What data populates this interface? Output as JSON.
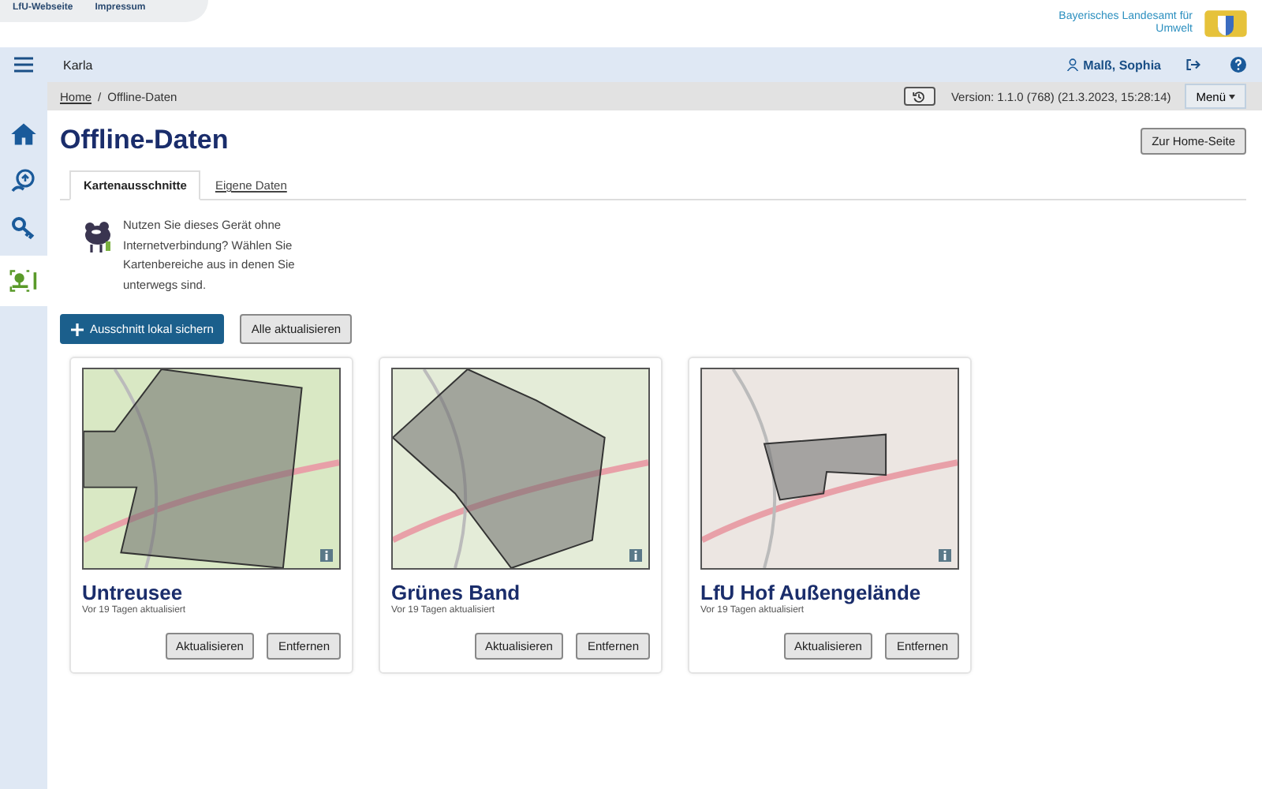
{
  "header": {
    "links": [
      "LfU-Webseite",
      "Impressum"
    ],
    "agency": "Bayerisches Landesamt für Umwelt"
  },
  "topbar": {
    "app_name": "Karla",
    "user": "Malß, Sophia"
  },
  "sidebar": {
    "items": [
      {
        "kind": "home",
        "selected": false
      },
      {
        "kind": "upload",
        "selected": false
      },
      {
        "kind": "key",
        "selected": false
      },
      {
        "kind": "map",
        "selected": true
      }
    ]
  },
  "breadcrumb": {
    "items": [
      "Home",
      "Offline-Daten"
    ],
    "separator": "/",
    "version": "Version: 1.1.0 (768) (21.3.2023, 15:28:14)",
    "menu": "Menü"
  },
  "page": {
    "title": "Offline-Daten",
    "home_button": "Zur Home-Seite"
  },
  "tabs": [
    {
      "label": "Kartenausschnitte",
      "selected": true
    },
    {
      "label": "Eigene Daten",
      "selected": false
    }
  ],
  "info": "Nutzen Sie dieses Gerät ohne Internetverbindung? Wählen Sie Kartenbereiche aus in denen Sie unterwegs sind.",
  "actions": {
    "primary": "Ausschnitt lokal sichern",
    "secondary": "Alle aktualisieren"
  },
  "areas": [
    {
      "name": "Untreusee",
      "updated": "Vor 19 Tagen aktualisiert",
      "buttons": [
        "Aktualisieren",
        "Entfernen"
      ]
    },
    {
      "name": "Grünes Band",
      "updated": "Vor 19 Tagen aktualisiert",
      "buttons": [
        "Aktualisieren",
        "Entfernen"
      ]
    },
    {
      "name": "LfU Hof Außengelände",
      "updated": "Vor 19 Tagen aktualisiert",
      "buttons": [
        "Aktualisieren",
        "Entfernen"
      ]
    }
  ]
}
